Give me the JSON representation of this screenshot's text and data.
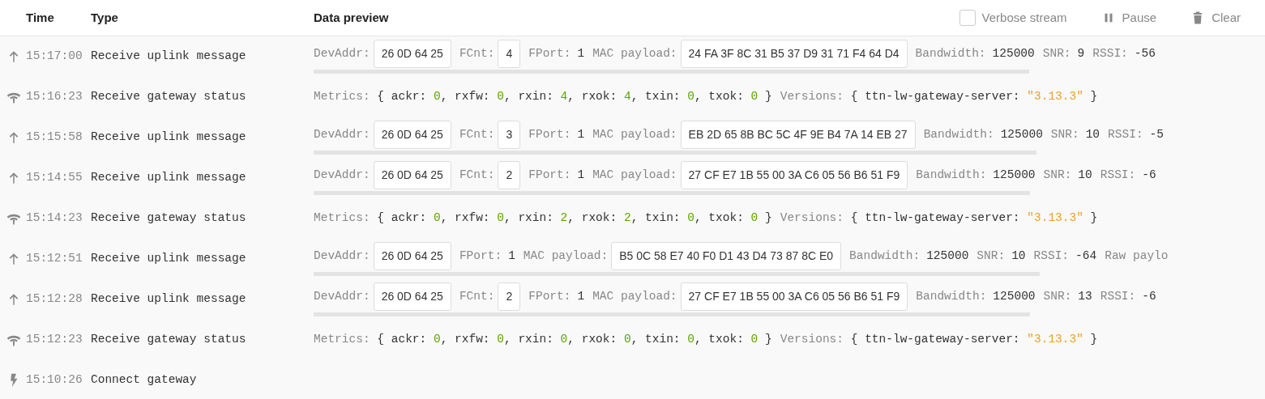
{
  "header": {
    "columns": [
      "Time",
      "Type",
      "Data preview"
    ],
    "verbose": {
      "label": "Verbose stream",
      "checked": false
    },
    "pause": "Pause",
    "clear": "Clear"
  },
  "events": [
    {
      "kind": "uplink",
      "time": "15:17:00",
      "type": "Receive uplink message",
      "fields": [
        {
          "kind": "box",
          "label": "DevAddr:",
          "value": "26 0D 64 25"
        },
        {
          "kind": "box",
          "label": "FCnt:",
          "value": "4"
        },
        {
          "kind": "plain",
          "label": "FPort:",
          "value": "1"
        },
        {
          "kind": "box",
          "label": "MAC payload:",
          "value": "24 FA 3F 8C 31 B5 37 D9 31 71 F4 64 D4"
        },
        {
          "kind": "plain",
          "label": "Bandwidth:",
          "value": "125000"
        },
        {
          "kind": "plain",
          "label": "SNR:",
          "value": "9"
        },
        {
          "kind": "plain",
          "label": "RSSI:",
          "value": "-56"
        }
      ]
    },
    {
      "kind": "status",
      "time": "15:16:23",
      "type": "Receive gateway status",
      "metrics": [
        {
          "kind": "label",
          "text": "Metrics:"
        },
        {
          "kind": "plain",
          "text": "{ ackr:"
        },
        {
          "kind": "number",
          "text": "0"
        },
        {
          "kind": "plain",
          "text": ", rxfw:"
        },
        {
          "kind": "number",
          "text": "0"
        },
        {
          "kind": "plain",
          "text": ", rxin:"
        },
        {
          "kind": "number",
          "text": "4"
        },
        {
          "kind": "plain",
          "text": ", rxok:"
        },
        {
          "kind": "number",
          "text": "4"
        },
        {
          "kind": "plain",
          "text": ", txin:"
        },
        {
          "kind": "number",
          "text": "0"
        },
        {
          "kind": "plain",
          "text": ", txok:"
        },
        {
          "kind": "number",
          "text": "0"
        },
        {
          "kind": "plain",
          "text": "}"
        }
      ],
      "versions": [
        {
          "kind": "label",
          "text": "Versions:"
        },
        {
          "kind": "plain",
          "text": "{ ttn-lw-gateway-server:"
        },
        {
          "kind": "string",
          "text": "\"3.13.3\""
        },
        {
          "kind": "plain",
          "text": "}"
        }
      ]
    },
    {
      "kind": "uplink",
      "time": "15:15:58",
      "type": "Receive uplink message",
      "fields": [
        {
          "kind": "box",
          "label": "DevAddr:",
          "value": "26 0D 64 25"
        },
        {
          "kind": "box",
          "label": "FCnt:",
          "value": "3"
        },
        {
          "kind": "plain",
          "label": "FPort:",
          "value": "1"
        },
        {
          "kind": "box",
          "label": "MAC payload:",
          "value": "EB 2D 65 8B BC 5C 4F 9E B4 7A 14 EB 27"
        },
        {
          "kind": "plain",
          "label": "Bandwidth:",
          "value": "125000"
        },
        {
          "kind": "plain",
          "label": "SNR:",
          "value": "10"
        },
        {
          "kind": "plain",
          "label": "RSSI:",
          "value": "-5"
        }
      ]
    },
    {
      "kind": "uplink",
      "time": "15:14:55",
      "type": "Receive uplink message",
      "fields": [
        {
          "kind": "box",
          "label": "DevAddr:",
          "value": "26 0D 64 25"
        },
        {
          "kind": "box",
          "label": "FCnt:",
          "value": "2"
        },
        {
          "kind": "plain",
          "label": "FPort:",
          "value": "1"
        },
        {
          "kind": "box",
          "label": "MAC payload:",
          "value": "27 CF E7 1B 55 00 3A C6 05 56 B6 51 F9"
        },
        {
          "kind": "plain",
          "label": "Bandwidth:",
          "value": "125000"
        },
        {
          "kind": "plain",
          "label": "SNR:",
          "value": "10"
        },
        {
          "kind": "plain",
          "label": "RSSI:",
          "value": "-6"
        }
      ]
    },
    {
      "kind": "status",
      "time": "15:14:23",
      "type": "Receive gateway status",
      "metrics": [
        {
          "kind": "label",
          "text": "Metrics:"
        },
        {
          "kind": "plain",
          "text": "{ ackr:"
        },
        {
          "kind": "number",
          "text": "0"
        },
        {
          "kind": "plain",
          "text": ", rxfw:"
        },
        {
          "kind": "number",
          "text": "0"
        },
        {
          "kind": "plain",
          "text": ", rxin:"
        },
        {
          "kind": "number",
          "text": "2"
        },
        {
          "kind": "plain",
          "text": ", rxok:"
        },
        {
          "kind": "number",
          "text": "2"
        },
        {
          "kind": "plain",
          "text": ", txin:"
        },
        {
          "kind": "number",
          "text": "0"
        },
        {
          "kind": "plain",
          "text": ", txok:"
        },
        {
          "kind": "number",
          "text": "0"
        },
        {
          "kind": "plain",
          "text": "}"
        }
      ],
      "versions": [
        {
          "kind": "label",
          "text": "Versions:"
        },
        {
          "kind": "plain",
          "text": "{ ttn-lw-gateway-server:"
        },
        {
          "kind": "string",
          "text": "\"3.13.3\""
        },
        {
          "kind": "plain",
          "text": "}"
        }
      ]
    },
    {
      "kind": "uplink",
      "time": "15:12:51",
      "type": "Receive uplink message",
      "fields": [
        {
          "kind": "box",
          "label": "DevAddr:",
          "value": "26 0D 64 25"
        },
        {
          "kind": "plain",
          "label": "FPort:",
          "value": "1"
        },
        {
          "kind": "box",
          "label": "MAC payload:",
          "value": "B5 0C 58 E7 40 F0 D1 43 D4 73 87 8C E0"
        },
        {
          "kind": "plain",
          "label": "Bandwidth:",
          "value": "125000"
        },
        {
          "kind": "plain",
          "label": "SNR:",
          "value": "10"
        },
        {
          "kind": "plain",
          "label": "RSSI:",
          "value": "-64"
        },
        {
          "kind": "label",
          "label": "Raw paylo"
        }
      ]
    },
    {
      "kind": "uplink",
      "time": "15:12:28",
      "type": "Receive uplink message",
      "fields": [
        {
          "kind": "box",
          "label": "DevAddr:",
          "value": "26 0D 64 25"
        },
        {
          "kind": "box",
          "label": "FCnt:",
          "value": "2"
        },
        {
          "kind": "plain",
          "label": "FPort:",
          "value": "1"
        },
        {
          "kind": "box",
          "label": "MAC payload:",
          "value": "27 CF E7 1B 55 00 3A C6 05 56 B6 51 F9"
        },
        {
          "kind": "plain",
          "label": "Bandwidth:",
          "value": "125000"
        },
        {
          "kind": "plain",
          "label": "SNR:",
          "value": "13"
        },
        {
          "kind": "plain",
          "label": "RSSI:",
          "value": "-6"
        }
      ]
    },
    {
      "kind": "status",
      "time": "15:12:23",
      "type": "Receive gateway status",
      "metrics": [
        {
          "kind": "label",
          "text": "Metrics:"
        },
        {
          "kind": "plain",
          "text": "{ ackr:"
        },
        {
          "kind": "number",
          "text": "0"
        },
        {
          "kind": "plain",
          "text": ", rxfw:"
        },
        {
          "kind": "number",
          "text": "0"
        },
        {
          "kind": "plain",
          "text": ", rxin:"
        },
        {
          "kind": "number",
          "text": "0"
        },
        {
          "kind": "plain",
          "text": ", rxok:"
        },
        {
          "kind": "number",
          "text": "0"
        },
        {
          "kind": "plain",
          "text": ", txin:"
        },
        {
          "kind": "number",
          "text": "0"
        },
        {
          "kind": "plain",
          "text": ", txok:"
        },
        {
          "kind": "number",
          "text": "0"
        },
        {
          "kind": "plain",
          "text": "}"
        }
      ],
      "versions": [
        {
          "kind": "label",
          "text": "Versions:"
        },
        {
          "kind": "plain",
          "text": "{ ttn-lw-gateway-server:"
        },
        {
          "kind": "string",
          "text": "\"3.13.3\""
        },
        {
          "kind": "plain",
          "text": "}"
        }
      ]
    },
    {
      "kind": "connect",
      "time": "15:10:26",
      "type": "Connect gateway"
    }
  ]
}
